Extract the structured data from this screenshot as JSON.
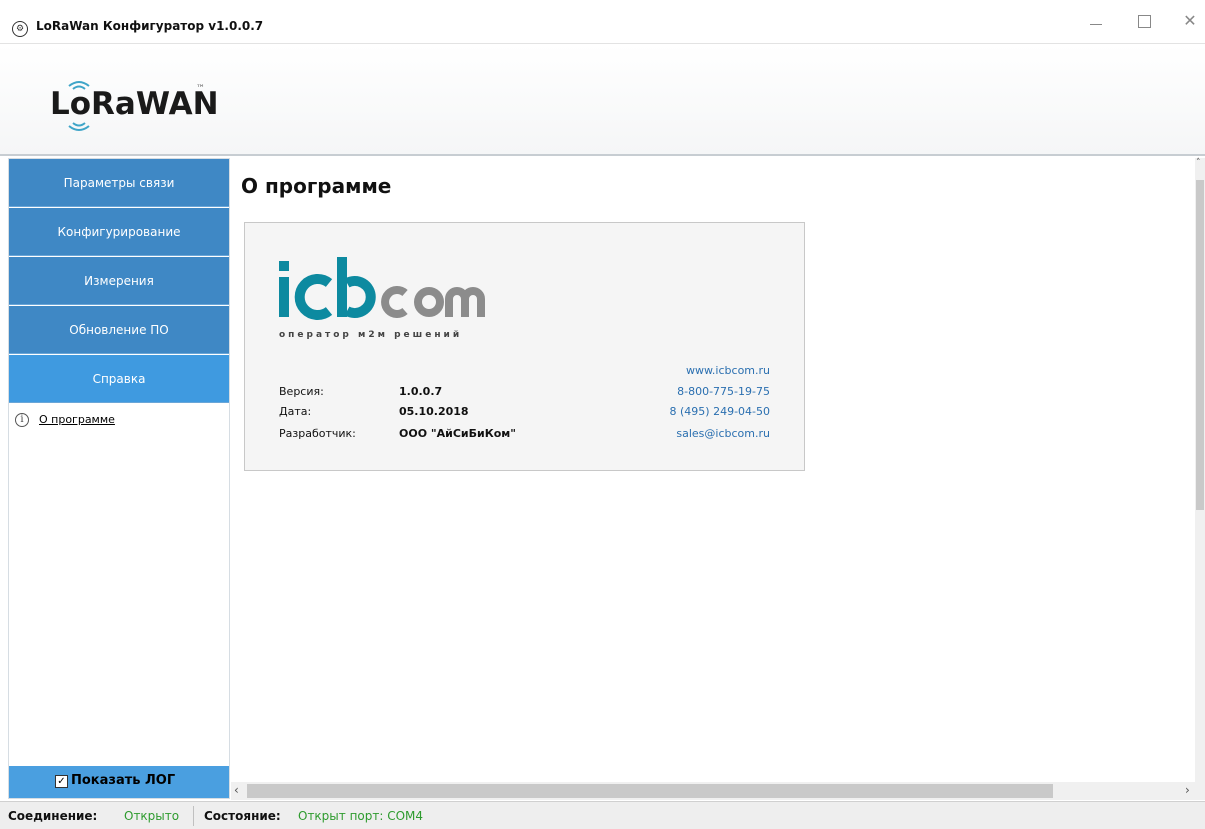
{
  "window": {
    "title": "LoRaWan Конфигуратор v1.0.0.7",
    "app_icon_glyph": "⚙"
  },
  "header": {
    "logo_text": "LoRaWAN",
    "logo_tm": "™"
  },
  "sidebar": {
    "items": [
      {
        "label": "Параметры связи"
      },
      {
        "label": "Конфигурирование"
      },
      {
        "label": "Измерения"
      },
      {
        "label": "Обновление ПО"
      },
      {
        "label": "Справка"
      }
    ],
    "active_index": 4,
    "subitems": [
      {
        "label": "О программе",
        "icon": "info-icon"
      }
    ],
    "show_log": {
      "label": "Показать ЛОГ",
      "checked": true
    }
  },
  "main": {
    "title": "О программе",
    "about": {
      "brand_logo": "icbcom",
      "tagline": "оператор м2м решений",
      "version_label": "Версия:",
      "version_value": "1.0.0.7",
      "date_label": "Дата:",
      "date_value": "05.10.2018",
      "developer_label": "Разработчик:",
      "developer_value": "ООО \"АйСиБиКом\"",
      "website": "www.icbcom.ru",
      "phone1": "8-800-775-19-75",
      "phone2": "8 (495) 249-04-50",
      "email": "sales@icbcom.ru"
    }
  },
  "status": {
    "connection_label": "Соединение:",
    "connection_value": "Открыто",
    "state_label": "Состояние:",
    "state_value": "Открыт порт: COM4"
  },
  "colors": {
    "nav_blue": "#3f88c5",
    "nav_active": "#3f9ae0",
    "icb_teal": "#0d8aa0",
    "icb_gray": "#8c8c8c",
    "status_green": "#2e9b2e",
    "link_blue": "#2a6fb0"
  }
}
